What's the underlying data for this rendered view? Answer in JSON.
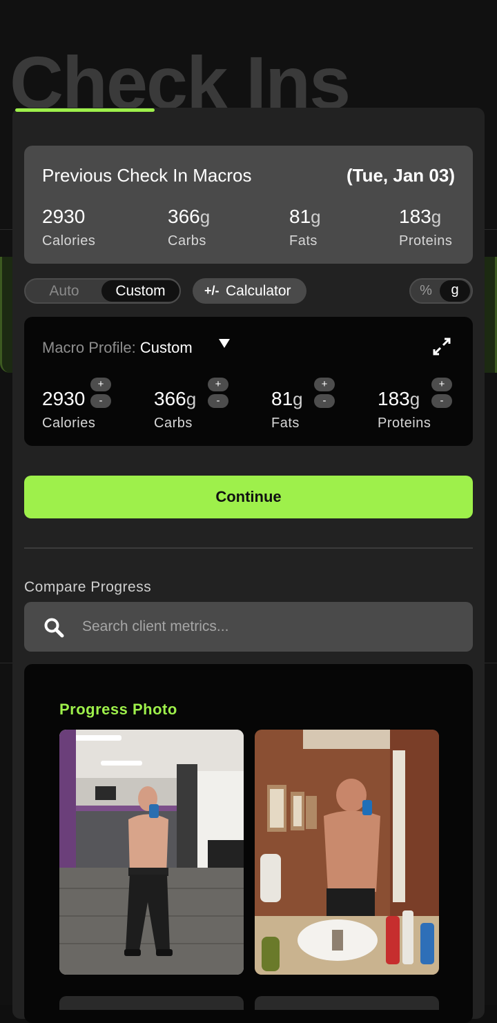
{
  "background": {
    "title": "Check Ins"
  },
  "previous": {
    "title": "Previous Check In Macros",
    "date": "(Tue, Jan 03)",
    "macros": [
      {
        "value": "2930",
        "unit": "",
        "label": "Calories"
      },
      {
        "value": "366",
        "unit": "g",
        "label": "Carbs"
      },
      {
        "value": "81",
        "unit": "g",
        "label": "Fats"
      },
      {
        "value": "183",
        "unit": "g",
        "label": "Proteins"
      }
    ]
  },
  "mode_toggle": {
    "auto": "Auto",
    "custom": "Custom",
    "selected": "Custom"
  },
  "calculator": {
    "icon": "+/-",
    "label": "Calculator"
  },
  "unit_toggle": {
    "percent": "%",
    "grams": "g",
    "selected": "g"
  },
  "editor": {
    "profile_label": "Macro Profile:",
    "profile_value": "Custom",
    "plus": "+",
    "minus": "-",
    "macros": [
      {
        "value": "2930",
        "unit": "",
        "label": "Calories"
      },
      {
        "value": "366",
        "unit": "g",
        "label": "Carbs"
      },
      {
        "value": "81",
        "unit": "g",
        "label": "Fats"
      },
      {
        "value": "183",
        "unit": "g",
        "label": "Proteins"
      }
    ]
  },
  "continue_label": "Continue",
  "compare": {
    "label": "Compare Progress",
    "search_placeholder": "Search client metrics..."
  },
  "photos": {
    "title": "Progress Photo"
  },
  "colors": {
    "accent": "#9ef04b",
    "sheet": "#222222",
    "card": "#4a4a4a"
  }
}
